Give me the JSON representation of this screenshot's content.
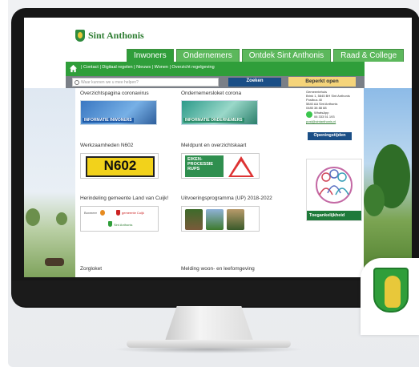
{
  "brand": {
    "name": "Sint Anthonis"
  },
  "tabs": [
    {
      "label": "Inwoners",
      "active": true
    },
    {
      "label": "Ondernemers",
      "active": false
    },
    {
      "label": "Ontdek Sint Anthonis",
      "active": false
    },
    {
      "label": "Raad & College",
      "active": false
    }
  ],
  "subnav": {
    "text": "| Contact | Digitaal regelen | Nieuws | Wonen | Overzicht regelgeving"
  },
  "search": {
    "placeholder": "Waar kunnen we u mee helpen?",
    "button": "Zoeken",
    "open_button": "Beperkt open"
  },
  "cards": {
    "c1": {
      "title": "Overzichtspagina coronavirus",
      "banner": "INFORMATIE INWONERS"
    },
    "c2": {
      "title": "Ondernemersloket corona",
      "banner": "INFORMATIE ONDERNEMERS"
    },
    "c3": {
      "title": "Werkzaamheden N602",
      "sign": "N602"
    },
    "c4": {
      "title": "Meldpunt en overzichtskaart",
      "sign": "EIKEN- PROCESSIE RUPS"
    },
    "c5": {
      "title": "Herindeling gemeente Land van Cuijk!",
      "names": [
        "Boxmeer",
        "gemeente Cuijk",
        "Sint Anthonis"
      ]
    },
    "c6": {
      "title": "Uitvoeringsprogramma (UP) 2018-2022"
    },
    "c7": {
      "title": "Zorgloket"
    },
    "c8": {
      "title": "Melding woon- en leefomgeving"
    }
  },
  "sidebar": {
    "heading": "Gemeentehuis",
    "address": [
      "Brink 1, 5845 BH Sint Anthonis",
      "Postbus 40",
      "5840 AA Sint Anthonis",
      "0485 38 88 88"
    ],
    "whatsapp": "WhatsApp",
    "whatsapp_number": "06 333 51 193",
    "email": "post@sintanthonis.nl",
    "openings_button": "Openingstijden",
    "accessibility": "Toegankelijkheid"
  },
  "colors": {
    "green": "#2f9e3a",
    "blue": "#1a4e86",
    "yellow": "#f5d47a"
  }
}
